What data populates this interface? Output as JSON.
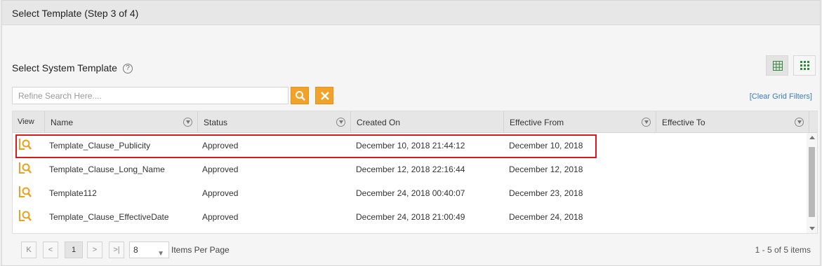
{
  "step": {
    "title": "Select Template (Step 3 of 4)"
  },
  "section": {
    "title": "Select System Template",
    "help_icon": "?"
  },
  "view_toggle": {
    "list_icon": "list-grid-icon",
    "tile_icon": "tile-grid-icon",
    "accent": "#2f8a3a"
  },
  "search": {
    "placeholder": "Refine Search Here....",
    "value": ""
  },
  "clear_filters": "[Clear Grid Filters]",
  "grid": {
    "columns": [
      "View",
      "Name",
      "Status",
      "Created On",
      "Effective From",
      "Effective To"
    ],
    "rows": [
      {
        "name": "Template_Clause_Publicity",
        "status": "Approved",
        "created_on": "December 10, 2018 21:44:12",
        "effective_from": "December 10, 2018",
        "effective_to": ""
      },
      {
        "name": "Template_Clause_Long_Name",
        "status": "Approved",
        "created_on": "December 12, 2018 22:16:44",
        "effective_from": "December 12, 2018",
        "effective_to": ""
      },
      {
        "name": "Template112",
        "status": "Approved",
        "created_on": "December 24, 2018 00:40:07",
        "effective_from": "December 23, 2018",
        "effective_to": ""
      },
      {
        "name": "Template_Clause_EffectiveDate",
        "status": "Approved",
        "created_on": "December 24, 2018 21:00:49",
        "effective_from": "December 24, 2018",
        "effective_to": ""
      }
    ]
  },
  "pager": {
    "first": "K",
    "prev": "<",
    "current_page": "1",
    "next": ">",
    "last": ">|",
    "items_per_page": "8",
    "items_per_page_label": "Items Per Page",
    "summary": "1 - 5 of 5 items"
  },
  "colors": {
    "accent_orange": "#f1a22b",
    "highlight_red": "#d71923",
    "link_blue": "#3a7bc1"
  }
}
